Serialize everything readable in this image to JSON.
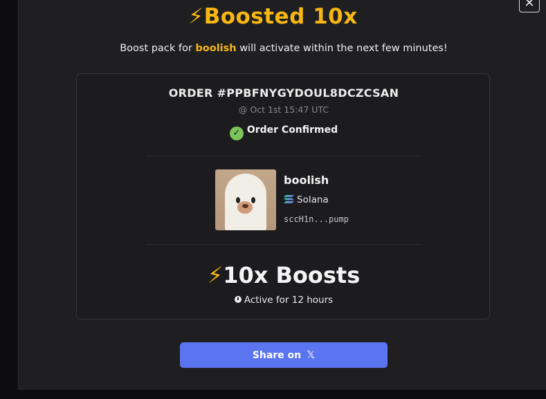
{
  "header": {
    "title_icon": "lightning-bolt-icon",
    "title_bolt": "⚡",
    "title": "Boosted 10x",
    "subtitle_prefix": "Boost pack for ",
    "subtitle_token": "boolish",
    "subtitle_suffix": " will activate within the next few minutes!",
    "close_glyph": "✕"
  },
  "order": {
    "id": "ORDER #PPBFNYGYDOUL8DCZCSAN",
    "time": "@ Oct 1st 15:47 UTC",
    "status": "Order Confirmed",
    "status_glyph": "✓"
  },
  "token": {
    "name": "boolish",
    "chain": "Solana",
    "address": "sccH1n...pump",
    "image_icon": "ghost-dog-avatar"
  },
  "boost": {
    "bolt": "⚡",
    "label": "10x Boosts",
    "active": "Active for 12 hours"
  },
  "share": {
    "label": "Share on",
    "x_glyph": "𝕏"
  },
  "colors": {
    "accent": "#f6b613",
    "share_button": "#5b74f0",
    "confirm_green": "#7cc55a"
  }
}
